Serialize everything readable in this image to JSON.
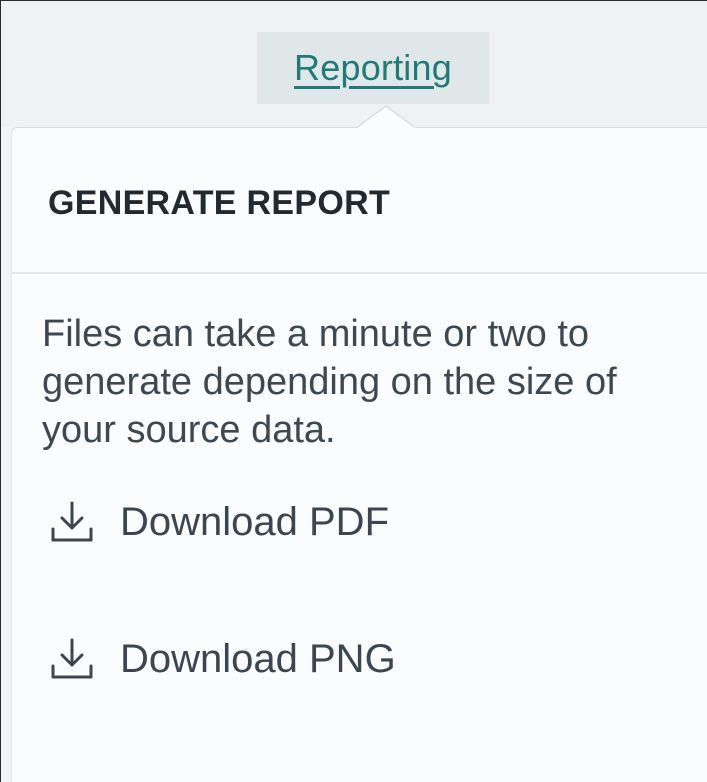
{
  "nav": {
    "active_tab_label": "Reporting"
  },
  "popover": {
    "title": "GENERATE REPORT",
    "description": "Files can take a minute or two to generate depending on the size of your source data.",
    "actions": [
      {
        "label": "Download PDF",
        "icon": "download-icon"
      },
      {
        "label": "Download PNG",
        "icon": "download-icon"
      }
    ]
  },
  "colors": {
    "accent": "#1f7a78",
    "tab_background": "#dfe7e8",
    "text": "#3e4851",
    "title": "#222a31"
  }
}
